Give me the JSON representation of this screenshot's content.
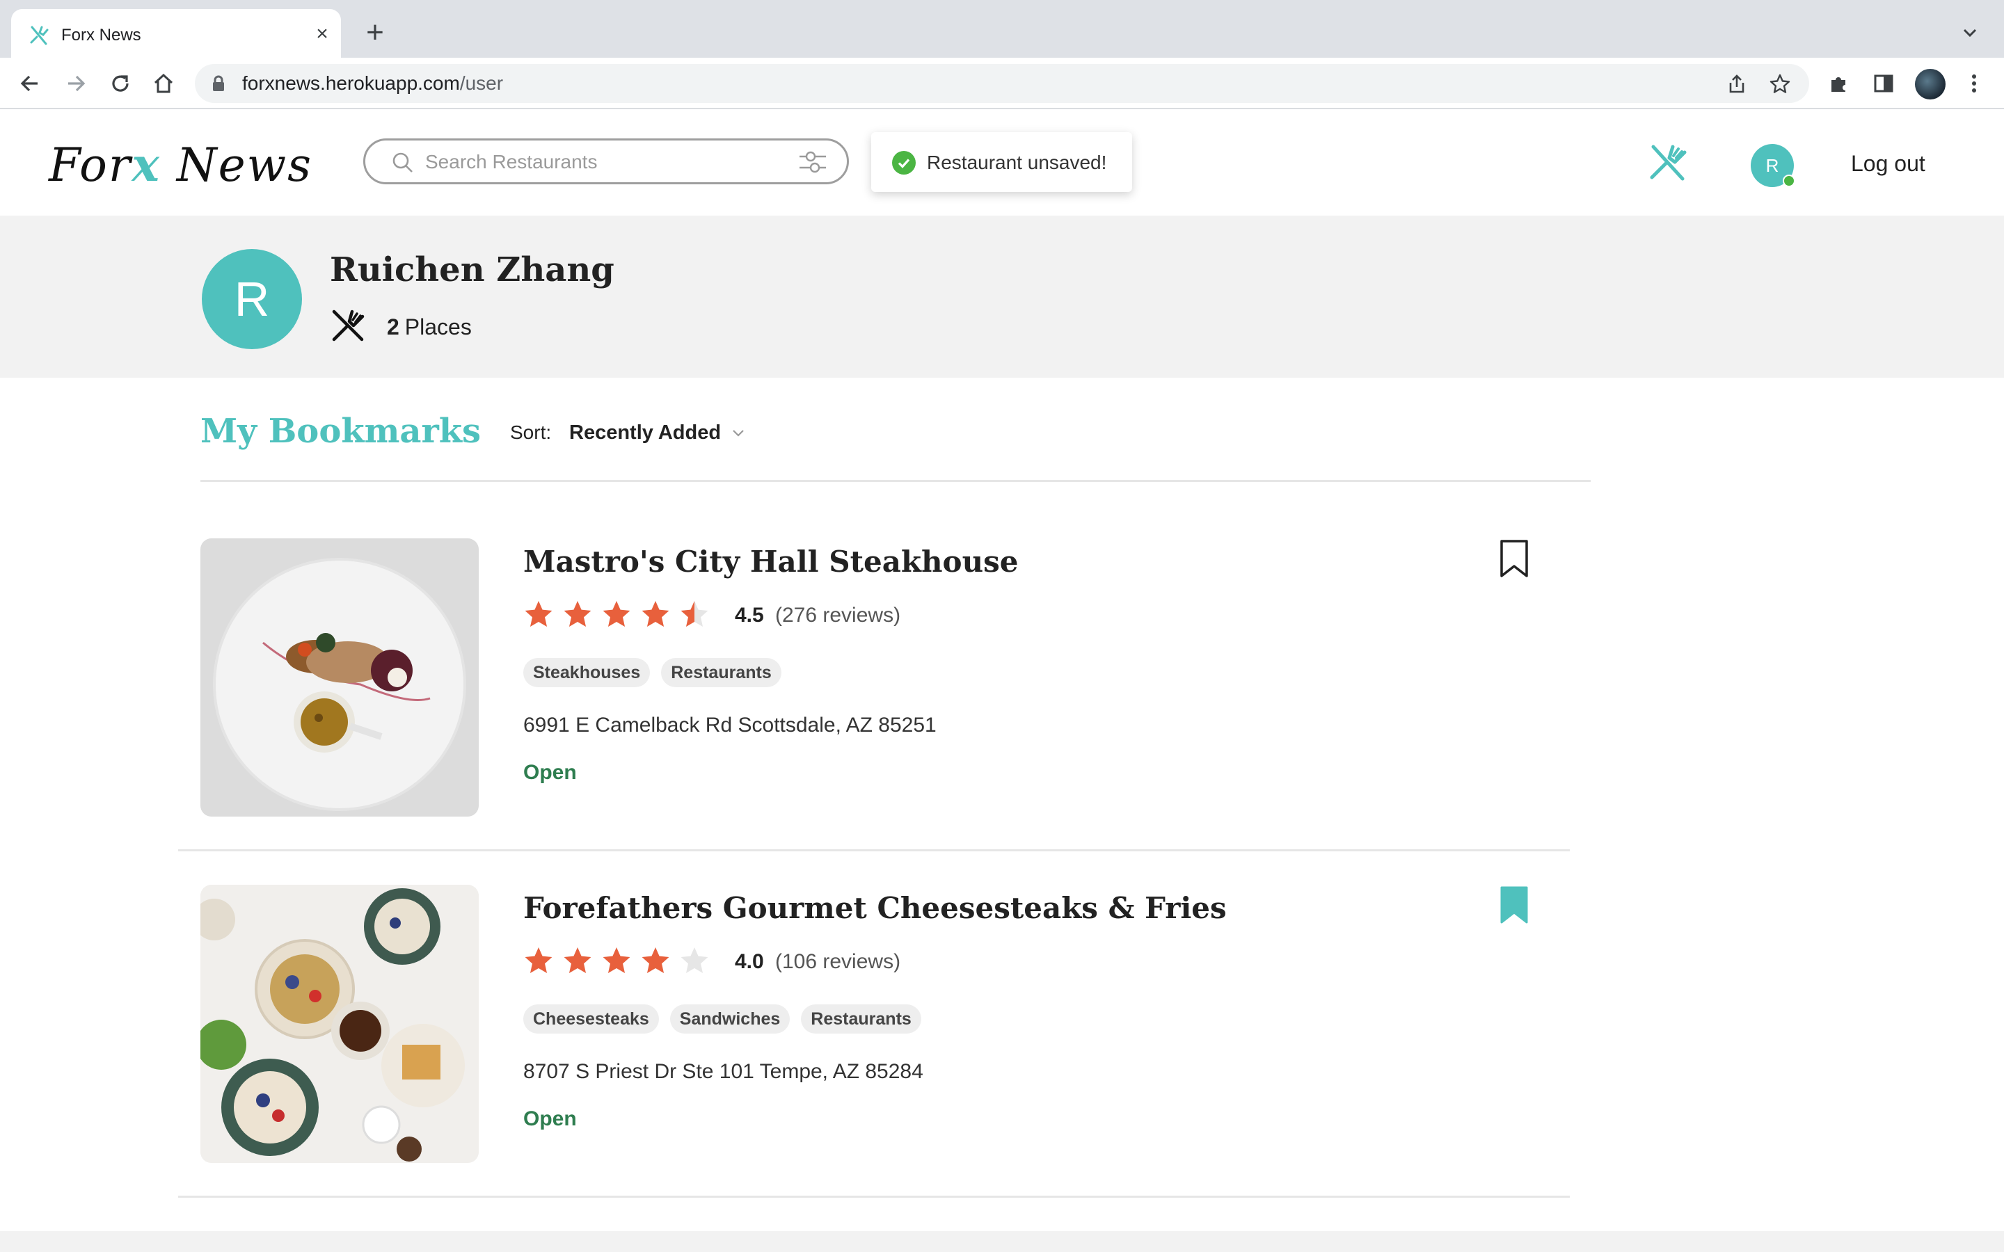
{
  "browser": {
    "tab_title": "Forx News",
    "url_host": "forxnews.herokuapp.com",
    "url_path": "/user"
  },
  "header": {
    "logo_prefix": "For",
    "logo_x": "x",
    "logo_suffix": " News",
    "search_placeholder": "Search Restaurants",
    "logout_label": "Log out",
    "avatar_initial": "R"
  },
  "toast": {
    "message": "Restaurant unsaved!"
  },
  "profile": {
    "initial": "R",
    "name": "Ruichen Zhang",
    "places_count": "2",
    "places_label": "Places"
  },
  "bookmarks": {
    "title": "My Bookmarks",
    "sort_label": "Sort:",
    "sort_value": "Recently Added",
    "items": [
      {
        "name": "Mastro's City Hall Steakhouse",
        "rating": "4.5",
        "rating_value": 4.5,
        "reviews": "(276 reviews)",
        "tags": [
          "Steakhouses",
          "Restaurants"
        ],
        "address": "6991 E Camelback Rd Scottsdale, AZ 85251",
        "status": "Open",
        "bookmarked": false
      },
      {
        "name": "Forefathers Gourmet Cheesesteaks & Fries",
        "rating": "4.0",
        "rating_value": 4.0,
        "reviews": "(106 reviews)",
        "tags": [
          "Cheesesteaks",
          "Sandwiches",
          "Restaurants"
        ],
        "address": "8707 S Priest Dr Ste 101 Tempe, AZ 85284",
        "status": "Open",
        "bookmarked": true
      }
    ]
  },
  "colors": {
    "accent": "#4fc1bd",
    "star": "#e8603c",
    "star_empty": "#e6e6e6",
    "open": "#2e7d4f",
    "toast_check": "#4bb543"
  },
  "icons": {
    "favicon": "forks-icon",
    "back": "arrow-left-icon",
    "forward": "arrow-right-icon",
    "reload": "reload-icon",
    "home": "home-icon",
    "share": "share-icon",
    "star": "bookmark-star-icon",
    "extensions": "puzzle-icon",
    "sidepanel": "side-panel-icon",
    "menu": "kebab-menu-icon"
  }
}
